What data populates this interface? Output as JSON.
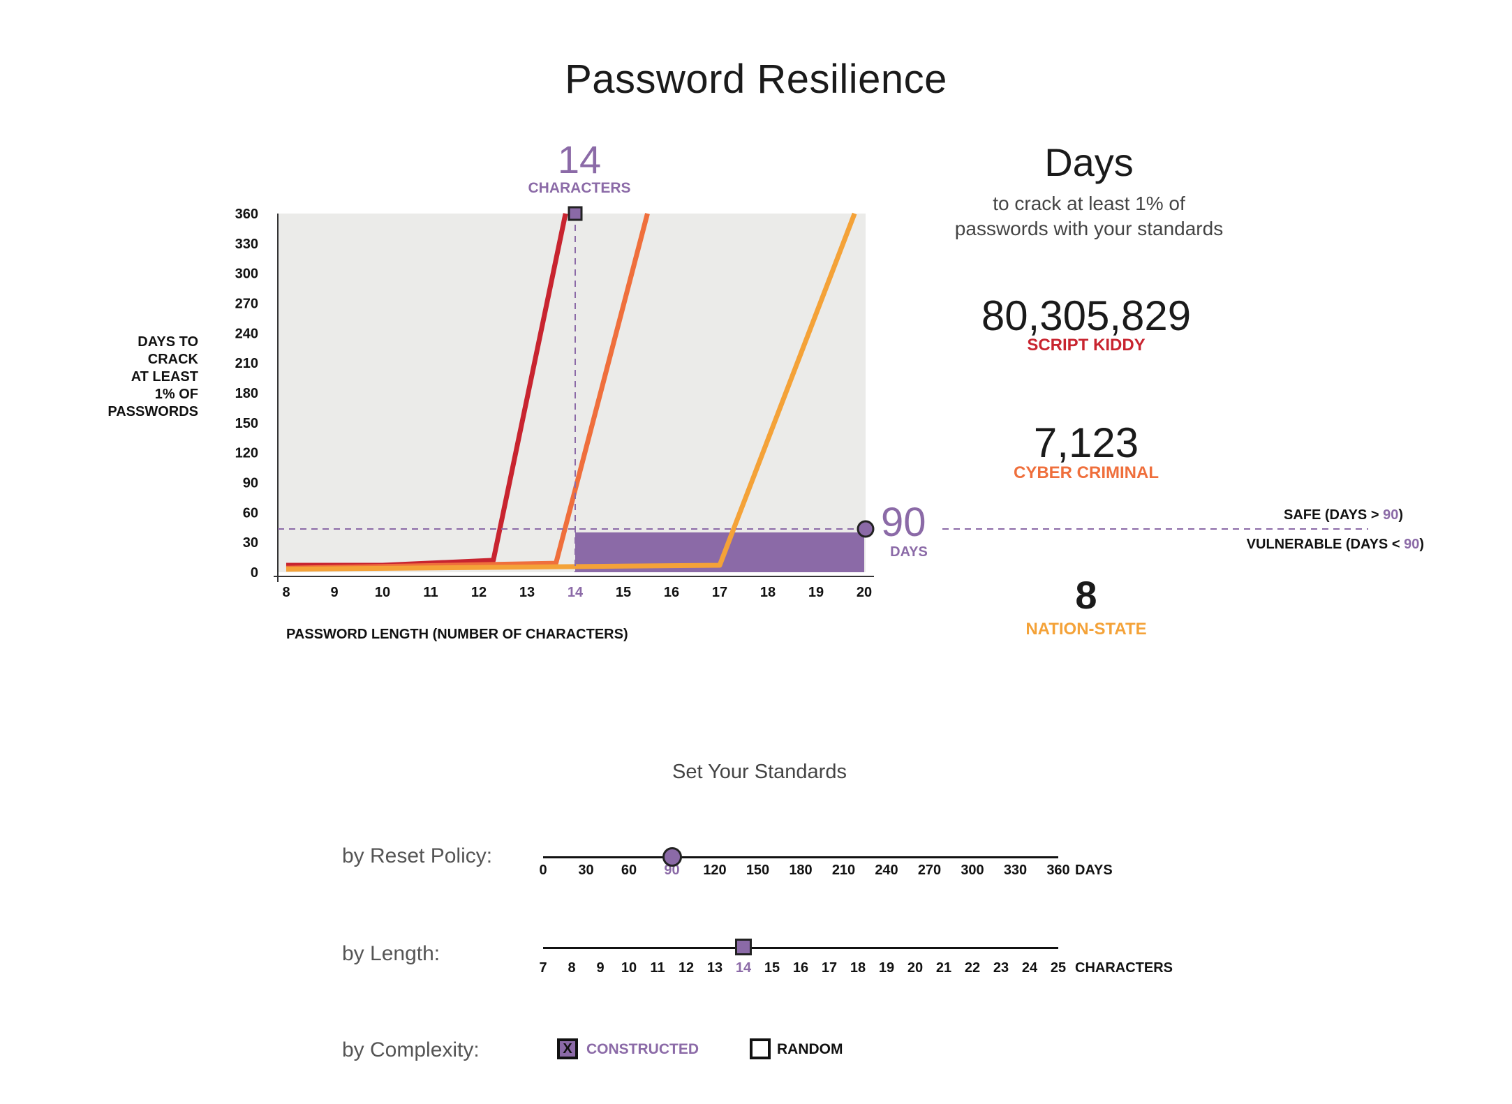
{
  "title": "Password Resilience",
  "chart_data": {
    "type": "line",
    "x": [
      8,
      9,
      10,
      11,
      12,
      13,
      14,
      15,
      16,
      17,
      18,
      19,
      20
    ],
    "x_ticks": [
      "8",
      "9",
      "10",
      "11",
      "12",
      "13",
      "14",
      "15",
      "16",
      "17",
      "18",
      "19",
      "20"
    ],
    "y_ticks": [
      "0",
      "30",
      "60",
      "90",
      "120",
      "150",
      "180",
      "210",
      "240",
      "270",
      "300",
      "330",
      "360"
    ],
    "ylim": [
      0,
      360
    ],
    "xlim": [
      8,
      20
    ],
    "xlabel": "PASSWORD LENGTH (NUMBER OF CHARACTERS)",
    "ylabel_lines": [
      "DAYS TO",
      "CRACK",
      "AT LEAST",
      "1% OF",
      "PASSWORDS"
    ],
    "series": [
      {
        "color": "#c8242f",
        "points": [
          [
            8,
            7
          ],
          [
            10,
            7
          ],
          [
            12.3,
            12
          ],
          [
            13.8,
            360
          ]
        ]
      },
      {
        "color": "#ef6f3c",
        "points": [
          [
            8,
            4
          ],
          [
            13.6,
            9
          ],
          [
            15.5,
            360
          ]
        ]
      },
      {
        "color": "#f4a238",
        "points": [
          [
            8,
            3
          ],
          [
            17,
            7
          ],
          [
            19.8,
            360
          ]
        ]
      }
    ],
    "selected_length": 14,
    "threshold_days": 90,
    "safe_zone": {
      "x_from": 14,
      "x_to": 20,
      "y_from": 0,
      "y_to": 40
    },
    "colors": {
      "accent": "#8b6aa7",
      "plot_bg": "#ebebe9"
    }
  },
  "selected": {
    "number": "14",
    "label": "CHARACTERS"
  },
  "threshold": {
    "number": "90",
    "label": "DAYS"
  },
  "zones": {
    "safe_prefix": "SAFE (DAYS > ",
    "safe_value": "90",
    "safe_suffix": ")",
    "vuln_prefix": "VULNERABLE (DAYS < ",
    "vuln_value": "90",
    "vuln_suffix": ")"
  },
  "summary": {
    "heading": "Days",
    "subtitle_line1": "to crack at least 1% of",
    "subtitle_line2": "passwords with your standards",
    "stats": [
      {
        "value": "80,305,829",
        "label": "SCRIPT KIDDY",
        "color": "#c8242f"
      },
      {
        "value": "7,123",
        "label": "CYBER CRIMINAL",
        "color": "#ef6f3c"
      },
      {
        "value": "8",
        "label": "NATION-STATE",
        "color": "#f4a238"
      }
    ]
  },
  "standards": {
    "title": "Set Your Standards",
    "reset": {
      "label": "by Reset Policy:",
      "ticks": [
        "0",
        "30",
        "60",
        "90",
        "120",
        "150",
        "180",
        "210",
        "240",
        "270",
        "300",
        "330",
        "360"
      ],
      "selected": "90",
      "selected_fraction": 0.25,
      "unit": "DAYS"
    },
    "length": {
      "label": "by Length:",
      "ticks": [
        "7",
        "8",
        "9",
        "10",
        "11",
        "12",
        "13",
        "14",
        "15",
        "16",
        "17",
        "18",
        "19",
        "20",
        "21",
        "22",
        "23",
        "24",
        "25"
      ],
      "selected": "14",
      "selected_fraction": 0.3889,
      "unit": "CHARACTERS"
    },
    "complexity": {
      "label": "by Complexity:",
      "options": [
        {
          "label": "CONSTRUCTED",
          "checked": true,
          "mark": "X"
        },
        {
          "label": "RANDOM",
          "checked": false,
          "mark": ""
        }
      ]
    }
  }
}
